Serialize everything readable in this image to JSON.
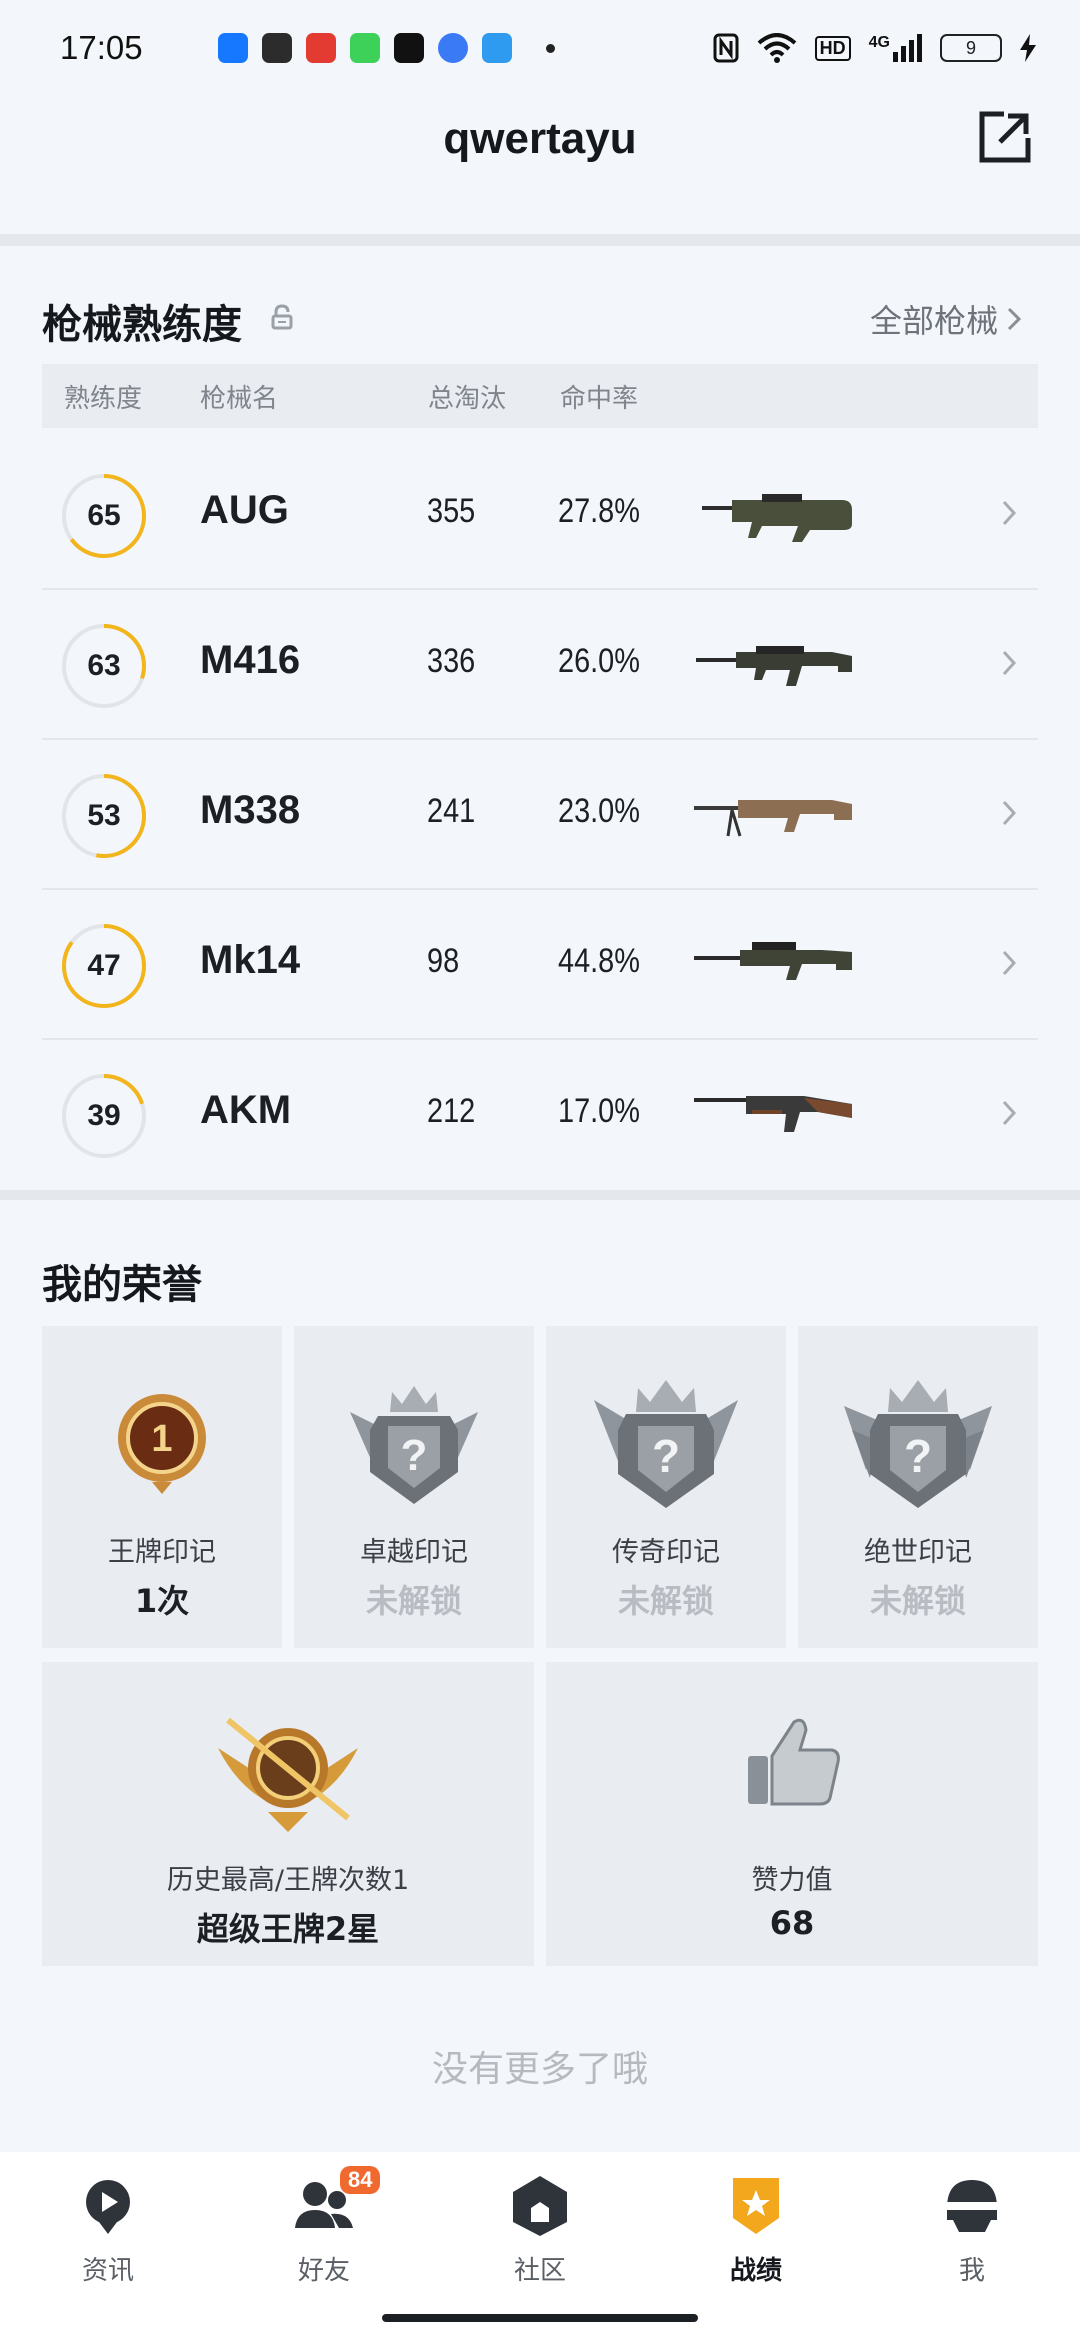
{
  "status_bar": {
    "time": "17:05",
    "right_icons": [
      "nfc-icon",
      "wifi-icon",
      "hd-icon",
      "4g-signal-icon"
    ],
    "hd_text": "HD",
    "net_text": "4G",
    "battery": "9"
  },
  "header": {
    "title": "qwertayu",
    "share_icon": "share-external-icon"
  },
  "weapons": {
    "title": "枪械熟练度",
    "all_link": "全部枪械",
    "columns": {
      "proficiency": "熟练度",
      "name": "枪械名",
      "kills": "总淘汰",
      "accuracy": "命中率"
    },
    "rows": [
      {
        "proficiency": "65",
        "level": 0.65,
        "name": "AUG",
        "kills": "355",
        "accuracy": "27.8%"
      },
      {
        "proficiency": "63",
        "level": 0.3,
        "name": "M416",
        "kills": "336",
        "accuracy": "26.0%"
      },
      {
        "proficiency": "53",
        "level": 0.53,
        "name": "M338",
        "kills": "241",
        "accuracy": "23.0%"
      },
      {
        "proficiency": "47",
        "level": 0.85,
        "name": "Mk14",
        "kills": "98",
        "accuracy": "44.8%"
      },
      {
        "proficiency": "39",
        "level": 0.2,
        "name": "AKM",
        "kills": "212",
        "accuracy": "17.0%"
      }
    ]
  },
  "honors": {
    "title": "我的荣誉",
    "cards": [
      {
        "label": "王牌印记",
        "value": "1次",
        "locked": false
      },
      {
        "label": "卓越印记",
        "value": "未解锁",
        "locked": true
      },
      {
        "label": "传奇印记",
        "value": "未解锁",
        "locked": true
      },
      {
        "label": "绝世印记",
        "value": "未解锁",
        "locked": true
      }
    ],
    "history": {
      "label": "历史最高/王牌次数1",
      "value": "超级王牌2星"
    },
    "likes": {
      "label": "赞力值",
      "value": "68"
    },
    "ace_badge_number": "1"
  },
  "footer_text": "没有更多了哦",
  "nav": {
    "items": [
      {
        "label": "资讯",
        "icon": "news-icon"
      },
      {
        "label": "好友",
        "icon": "friends-icon",
        "badge": "84"
      },
      {
        "label": "社区",
        "icon": "community-icon"
      },
      {
        "label": "战绩",
        "icon": "record-icon",
        "active": true
      },
      {
        "label": "我",
        "icon": "profile-helmet-icon"
      }
    ]
  },
  "colors": {
    "accent": "#f2b51c",
    "background": "#f3f6fa",
    "card": "#e9ecf1",
    "badge": "#f06a30"
  }
}
